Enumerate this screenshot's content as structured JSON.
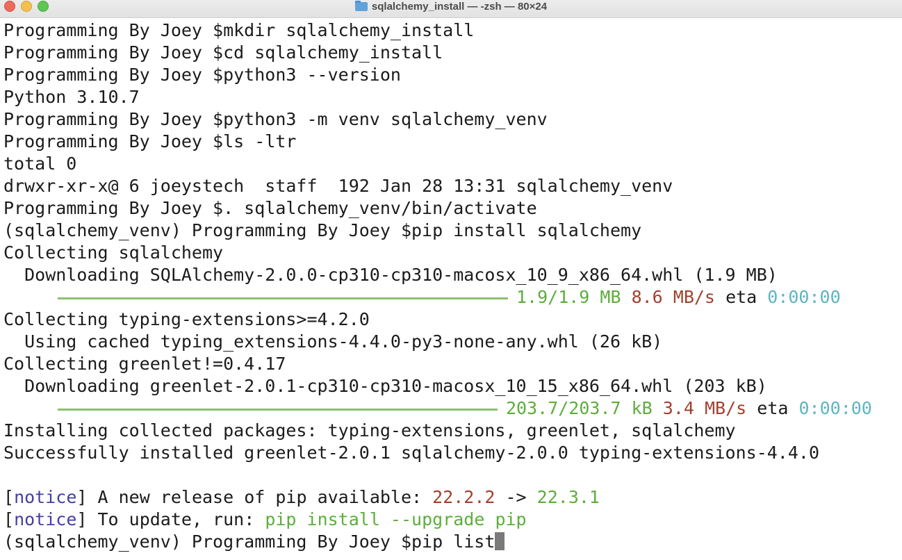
{
  "window": {
    "title": "sqlalchemy_install — -zsh — 80×24"
  },
  "terminal": {
    "lines": [
      "Programming By Joey $mkdir sqlalchemy_install",
      "Programming By Joey $cd sqlalchemy_install",
      "Programming By Joey $python3 --version",
      "Python 3.10.7",
      "Programming By Joey $python3 -m venv sqlalchemy_venv",
      "Programming By Joey $ls -ltr",
      "total 0",
      "drwxr-xr-x@ 6 joeystech  staff  192 Jan 28 13:31 sqlalchemy_venv",
      "Programming By Joey $. sqlalchemy_venv/bin/activate",
      "(sqlalchemy_venv) Programming By Joey $pip install sqlalchemy",
      "Collecting sqlalchemy",
      "  Downloading SQLAlchemy-2.0.0-cp310-cp310-macosx_10_9_x86_64.whl (1.9 MB)"
    ],
    "progress1": {
      "fraction": 1.0,
      "size": "1.9/1.9 MB",
      "speed": "8.6 MB/s",
      "eta_label": "eta",
      "eta": "0:00:00"
    },
    "lines2": [
      "Collecting typing-extensions>=4.2.0",
      "  Using cached typing_extensions-4.4.0-py3-none-any.whl (26 kB)",
      "Collecting greenlet!=0.4.17",
      "  Downloading greenlet-2.0.1-cp310-cp310-macosx_10_15_x86_64.whl (203 kB)"
    ],
    "progress2": {
      "fraction": 1.0,
      "size": "203.7/203.7 kB",
      "speed": "3.4 MB/s",
      "eta_label": "eta",
      "eta": "0:00:00"
    },
    "lines3": [
      "Installing collected packages: typing-extensions, greenlet, sqlalchemy",
      "Successfully installed greenlet-2.0.1 sqlalchemy-2.0.0 typing-extensions-4.4.0"
    ],
    "notice1": {
      "open": "[",
      "tag": "notice",
      "close": "]",
      "text": " A new release of pip available: ",
      "old": "22.2.2",
      "arrow": " -> ",
      "new": "22.3.1"
    },
    "notice2": {
      "open": "[",
      "tag": "notice",
      "close": "]",
      "text": " To update, run: ",
      "cmd": "pip install --upgrade pip"
    },
    "prompt": "(sqlalchemy_venv) Programming By Joey $pip list"
  },
  "colors": {
    "green": "#5cae3c",
    "red": "#a2402f",
    "cyan": "#5eb4c2",
    "blue": "#453fa0"
  }
}
